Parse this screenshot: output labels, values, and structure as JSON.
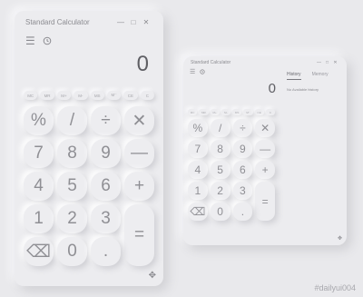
{
  "large": {
    "title": "Standard Calculator",
    "display": "0",
    "menu_icon": "hamburger-menu-icon",
    "history_icon": "history-icon",
    "memory_keys": [
      "MC",
      "MR",
      "M+",
      "M-",
      "MS",
      "M⁻",
      "CE",
      "C"
    ],
    "keys": [
      {
        "label": "%",
        "name": "percent-key"
      },
      {
        "label": "/",
        "name": "divide-slash-key"
      },
      {
        "label": "÷",
        "name": "divide-key"
      },
      {
        "label": "✕",
        "name": "multiply-key"
      },
      {
        "label": "7",
        "name": "digit-7-key"
      },
      {
        "label": "8",
        "name": "digit-8-key"
      },
      {
        "label": "9",
        "name": "digit-9-key"
      },
      {
        "label": "—",
        "name": "subtract-key"
      },
      {
        "label": "4",
        "name": "digit-4-key"
      },
      {
        "label": "5",
        "name": "digit-5-key"
      },
      {
        "label": "6",
        "name": "digit-6-key"
      },
      {
        "label": "+",
        "name": "add-key"
      },
      {
        "label": "1",
        "name": "digit-1-key"
      },
      {
        "label": "2",
        "name": "digit-2-key"
      },
      {
        "label": "3",
        "name": "digit-3-key"
      },
      {
        "label": "=",
        "name": "equals-key"
      },
      {
        "label": "⌫",
        "name": "backspace-key"
      },
      {
        "label": "0",
        "name": "digit-0-key"
      },
      {
        "label": ".",
        "name": "decimal-key"
      }
    ]
  },
  "small": {
    "title": "Standard Calculator",
    "display": "0",
    "tabs": [
      "History",
      "Memory"
    ],
    "history_empty": "No Available history",
    "memory_keys": [
      "MC",
      "MR",
      "M+",
      "M-",
      "MS",
      "M⁻",
      "CE",
      "C"
    ],
    "keys": [
      {
        "label": "%",
        "name": "percent-key"
      },
      {
        "label": "/",
        "name": "divide-slash-key"
      },
      {
        "label": "÷",
        "name": "divide-key"
      },
      {
        "label": "✕",
        "name": "multiply-key"
      },
      {
        "label": "7",
        "name": "digit-7-key"
      },
      {
        "label": "8",
        "name": "digit-8-key"
      },
      {
        "label": "9",
        "name": "digit-9-key"
      },
      {
        "label": "—",
        "name": "subtract-key"
      },
      {
        "label": "4",
        "name": "digit-4-key"
      },
      {
        "label": "5",
        "name": "digit-5-key"
      },
      {
        "label": "6",
        "name": "digit-6-key"
      },
      {
        "label": "+",
        "name": "add-key"
      },
      {
        "label": "1",
        "name": "digit-1-key"
      },
      {
        "label": "2",
        "name": "digit-2-key"
      },
      {
        "label": "3",
        "name": "digit-3-key"
      },
      {
        "label": "=",
        "name": "equals-key"
      },
      {
        "label": "⌫",
        "name": "backspace-key"
      },
      {
        "label": "0",
        "name": "digit-0-key"
      },
      {
        "label": ".",
        "name": "decimal-key"
      }
    ]
  },
  "window_controls": {
    "minimize": "—",
    "maximize": "□",
    "close": "✕"
  },
  "brand_tag": "#dailyui004"
}
